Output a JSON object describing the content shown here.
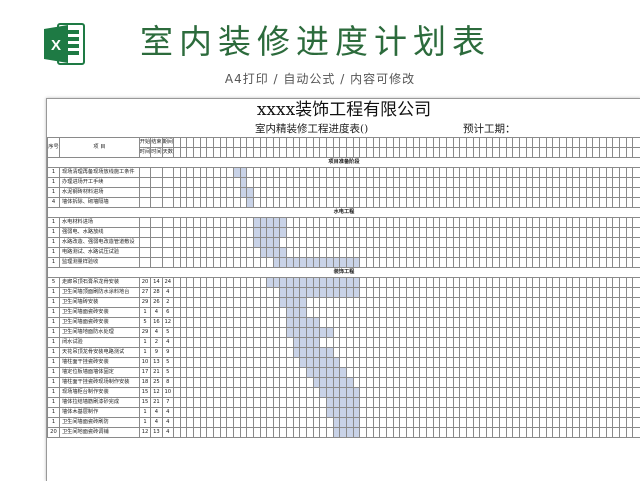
{
  "banner": {
    "logo_icon": "excel-icon",
    "title": "室内装修进度计划表",
    "subtitle": "A4打印 / 自动公式 / 内容可修改",
    "accent_color": "#2c6b3c"
  },
  "sheet": {
    "company": "xxxx装饰工程有限公司",
    "table_title": "室内精装修工程进度表()",
    "planned_label": "预计工期：",
    "headers": {
      "seq": "序号",
      "item": "项   目",
      "start": "开始",
      "end": "结束",
      "duration": "期间",
      "start2": "时间",
      "end2": "时间",
      "duration2": "天数"
    },
    "fill_color": "#c9d3e8",
    "day_columns": 70,
    "sections": [
      {
        "title": "项目准备阶段",
        "rows": [
          {
            "no": "1",
            "task": "现场清理再备现场放线施工条件",
            "start": "",
            "end": "",
            "days": "",
            "bar": [
              9,
              11
            ]
          },
          {
            "no": "1",
            "task": "办理进场开工手续",
            "start": "",
            "end": "",
            "days": "",
            "bar": [
              10,
              11
            ]
          },
          {
            "no": "1",
            "task": "水泥钢砖材料进场",
            "start": "",
            "end": "",
            "days": "",
            "bar": [
              10,
              12
            ]
          },
          {
            "no": "4",
            "task": "墙体拆除、砌墙隔墙",
            "start": "",
            "end": "",
            "days": "",
            "bar": [
              11,
              12
            ]
          }
        ]
      },
      {
        "title": "水电工程",
        "rows": [
          {
            "no": "1",
            "task": "水电材料进场",
            "start": "",
            "end": "",
            "days": "",
            "bar": [
              12,
              17
            ]
          },
          {
            "no": "1",
            "task": "强弱电、水路放线",
            "start": "",
            "end": "",
            "days": "",
            "bar": [
              12,
              17
            ]
          },
          {
            "no": "1",
            "task": "水路改造、强弱电改造管道敷设",
            "start": "",
            "end": "",
            "days": "",
            "bar": [
              12,
              16
            ]
          },
          {
            "no": "1",
            "task": "电路测试、水路试压试验",
            "start": "",
            "end": "",
            "days": "",
            "bar": [
              13,
              17
            ]
          },
          {
            "no": "1",
            "task": "监理测量样验收",
            "start": "",
            "end": "",
            "days": "",
            "bar": [
              15,
              28
            ]
          }
        ]
      },
      {
        "title": "装饰工程",
        "rows": [
          {
            "no": "5",
            "task": "走廊吊顶石膏吊龙骨安装",
            "start": "20",
            "end": "14",
            "days": "24",
            "bar": [
              14,
              28
            ]
          },
          {
            "no": "1",
            "task": "卫生间墙顶面刷防水涂料地台",
            "start": "27",
            "end": "28",
            "days": "4",
            "bar": [
              16,
              28
            ]
          },
          {
            "no": "1",
            "task": "卫生间墙砖安装",
            "start": "29",
            "end": "26",
            "days": "2",
            "bar": [
              16,
              20
            ]
          },
          {
            "no": "1",
            "task": "卫生间墙面瓷砖安装",
            "start": "1",
            "end": "4",
            "days": "6",
            "bar": [
              17,
              20
            ]
          },
          {
            "no": "1",
            "task": "卫生间墙面瓷砖安装",
            "start": "5",
            "end": "16",
            "days": "12",
            "bar": [
              17,
              22
            ]
          },
          {
            "no": "1",
            "task": "卫生间墙地面防水处理",
            "start": "29",
            "end": "4",
            "days": "5",
            "bar": [
              17,
              24
            ]
          },
          {
            "no": "1",
            "task": "闭水试验",
            "start": "1",
            "end": "2",
            "days": "4",
            "bar": [
              18,
              22
            ]
          },
          {
            "no": "1",
            "task": "天花吊顶龙骨安装电路测试",
            "start": "1",
            "end": "9",
            "days": "9",
            "bar": [
              18,
              24
            ]
          },
          {
            "no": "1",
            "task": "墙柱面干挂瓷砖安装",
            "start": "10",
            "end": "13",
            "days": "5",
            "bar": [
              19,
              25
            ]
          },
          {
            "no": "1",
            "task": "墙定位板墙面墙体固定",
            "start": "17",
            "end": "21",
            "days": "5",
            "bar": [
              20,
              26
            ]
          },
          {
            "no": "1",
            "task": "墙柱面干挂瓷砖现场制作安装",
            "start": "18",
            "end": "25",
            "days": "8",
            "bar": [
              21,
              27
            ]
          },
          {
            "no": "1",
            "task": "现场墙柜台制作安装",
            "start": "15",
            "end": "12",
            "days": "10",
            "bar": [
              22,
              28
            ]
          },
          {
            "no": "1",
            "task": "墙体拉结墙筋刷漆砂完成",
            "start": "15",
            "end": "21",
            "days": "7",
            "bar": [
              23,
              28
            ]
          },
          {
            "no": "1",
            "task": "墙体木基层制作",
            "start": "1",
            "end": "4",
            "days": "4",
            "bar": [
              23,
              28
            ]
          },
          {
            "no": "1",
            "task": "卫生间墙面瓷砖刷防",
            "start": "1",
            "end": "4",
            "days": "4",
            "bar": [
              24,
              28
            ]
          },
          {
            "no": "20",
            "task": "卫生间地面瓷砖调铺",
            "start": "12",
            "end": "13",
            "days": "4",
            "bar": [
              24,
              28
            ]
          }
        ]
      }
    ]
  }
}
